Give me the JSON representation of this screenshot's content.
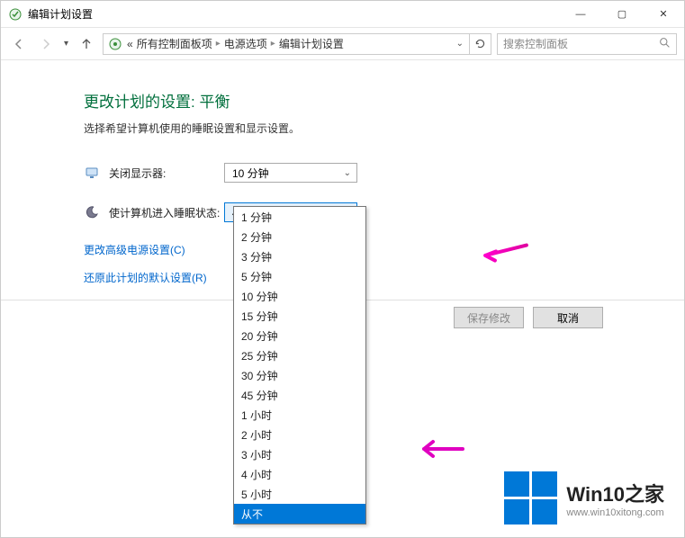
{
  "window": {
    "title": "编辑计划设置",
    "minimize": "—",
    "maximize": "▢",
    "close": "✕"
  },
  "breadcrumb": {
    "prefix": "«",
    "items": [
      "所有控制面板项",
      "电源选项",
      "编辑计划设置"
    ]
  },
  "search": {
    "placeholder": "搜索控制面板"
  },
  "page": {
    "heading": "更改计划的设置: 平衡",
    "subtext": "选择希望计算机使用的睡眠设置和显示设置。"
  },
  "rows": {
    "display_off": {
      "label": "关闭显示器:",
      "value": "10 分钟"
    },
    "sleep": {
      "label": "使计算机进入睡眠状态:",
      "value": "45 分钟"
    }
  },
  "links": {
    "advanced": "更改高级电源设置(C)",
    "restore": "还原此计划的默认设置(R)"
  },
  "buttons": {
    "save": "保存修改",
    "cancel": "取消"
  },
  "dropdown": {
    "options": [
      "1 分钟",
      "2 分钟",
      "3 分钟",
      "5 分钟",
      "10 分钟",
      "15 分钟",
      "20 分钟",
      "25 分钟",
      "30 分钟",
      "45 分钟",
      "1 小时",
      "2 小时",
      "3 小时",
      "4 小时",
      "5 小时",
      "从不"
    ],
    "highlighted": "从不"
  },
  "watermark": {
    "title": "Win10之家",
    "url": "www.win10xitong.com"
  }
}
